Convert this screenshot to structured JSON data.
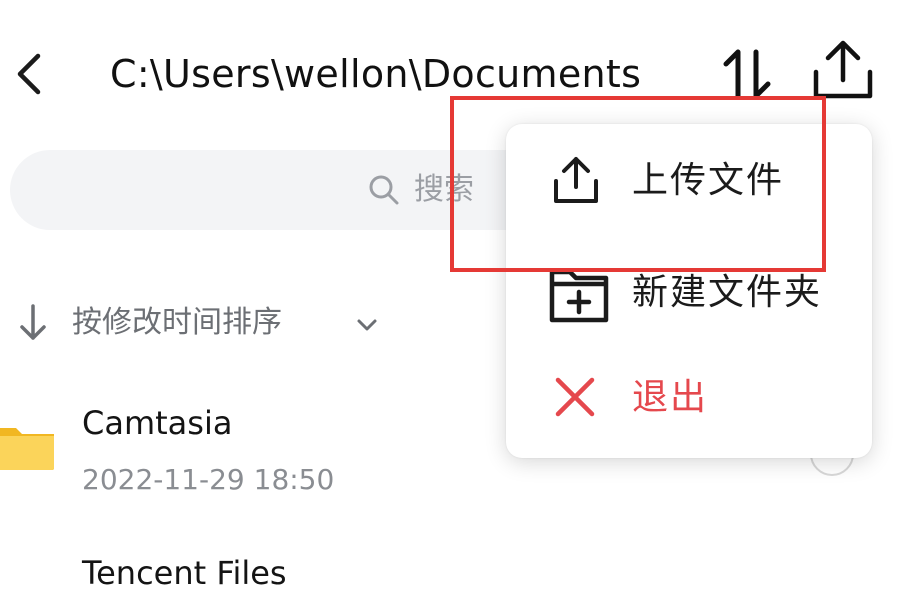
{
  "header": {
    "path": "C:\\Users\\wellon\\Documents",
    "back_icon": "chevron-left-icon",
    "sort_icon": "sort-arrows-icon",
    "share_icon": "upload-icon"
  },
  "search": {
    "placeholder": "搜索",
    "icon": "search-icon"
  },
  "sort": {
    "label": "按修改时间排序",
    "icon": "arrow-down-icon"
  },
  "files": [
    {
      "name": "Camtasia",
      "date": "2022-11-29 18:50",
      "type": "folder"
    },
    {
      "name": "Tencent Files",
      "date": "",
      "type": "folder"
    }
  ],
  "menu": {
    "items": [
      {
        "label": "上传文件",
        "icon": "upload-icon",
        "color": "#1b1b1b"
      },
      {
        "label": "新建文件夹",
        "icon": "new-folder-icon",
        "color": "#1b1b1b"
      },
      {
        "label": "退出",
        "icon": "close-icon",
        "color": "#e5484d"
      }
    ]
  },
  "colors": {
    "accent_red": "#e53935",
    "exit_red": "#e5484d",
    "folder_yellow": "#f9c931"
  }
}
